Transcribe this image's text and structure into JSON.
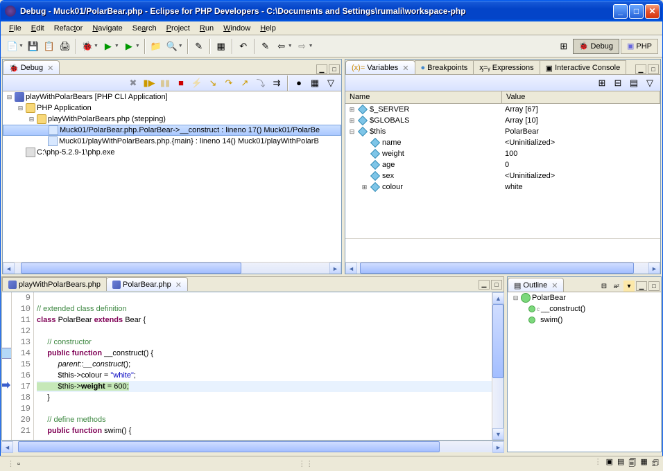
{
  "titlebar": {
    "title": "Debug - Muck01/PolarBear.php - Eclipse for PHP Developers - C:\\Documents and Settings\\rumali\\workspace-php"
  },
  "menu": {
    "file": "File",
    "edit": "Edit",
    "refactor": "Refactor",
    "navigate": "Navigate",
    "search": "Search",
    "project": "Project",
    "run": "Run",
    "window": "Window",
    "help": "Help"
  },
  "perspectives": {
    "debug": "Debug",
    "php": "PHP"
  },
  "debug_view": {
    "tab": "Debug",
    "root": "playWithPolarBears [PHP CLI Application]",
    "app": "PHP Application",
    "thread": "playWithPolarBears.php (stepping)",
    "frame0": "Muck01/PolarBear.php.PolarBear->__construct : lineno 17() Muck01/PolarBe",
    "frame1": "Muck01/playWithPolarBears.php.{main} : lineno 14() Muck01/playWithPolarB",
    "exe": "C:\\php-5.2.9-1\\php.exe"
  },
  "vars_view": {
    "tabs": {
      "variables": "Variables",
      "breakpoints": "Breakpoints",
      "expressions": "Expressions",
      "console": "Interactive Console"
    },
    "cols": {
      "name": "Name",
      "value": "Value"
    },
    "rows": [
      {
        "depth": 0,
        "tw": "⊞",
        "name": "$_SERVER",
        "val": "Array [67]"
      },
      {
        "depth": 0,
        "tw": "⊞",
        "name": "$GLOBALS",
        "val": "Array [10]"
      },
      {
        "depth": 0,
        "tw": "⊟",
        "name": "$this",
        "val": "PolarBear"
      },
      {
        "depth": 1,
        "tw": "",
        "name": "name",
        "val": "<Uninitialized>"
      },
      {
        "depth": 1,
        "tw": "",
        "name": "weight",
        "val": "100"
      },
      {
        "depth": 1,
        "tw": "",
        "name": "age",
        "val": "0"
      },
      {
        "depth": 1,
        "tw": "",
        "name": "sex",
        "val": "<Uninitialized>"
      },
      {
        "depth": 1,
        "tw": "⊞",
        "name": "colour",
        "val": "white"
      }
    ]
  },
  "editors": {
    "tab0": "playWithPolarBears.php",
    "tab1": "PolarBear.php",
    "lines": {
      "l9": "",
      "l10": "// extended class definition",
      "l12": "",
      "l13": "     // constructor",
      "l18": "     }",
      "l19": "",
      "l20": "     // define methods"
    }
  },
  "outline": {
    "tab": "Outline",
    "root": "PolarBear",
    "m0": "__construct()",
    "m1": "swim()"
  }
}
